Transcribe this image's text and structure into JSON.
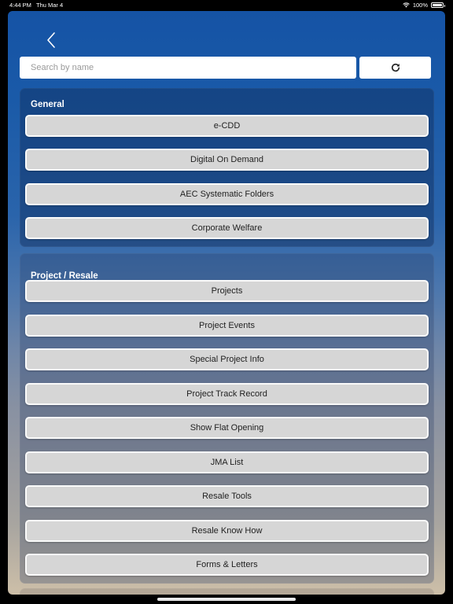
{
  "status_bar": {
    "time": "4:44 PM",
    "date": "Thu Mar 4",
    "battery": "100%"
  },
  "search": {
    "placeholder": "Search by name",
    "value": ""
  },
  "icons": {
    "back": "chevron-left-icon",
    "refresh": "refresh-icon"
  },
  "sections": {
    "general": {
      "title": "General",
      "items": [
        "e-CDD",
        "Digital On Demand",
        "AEC Systematic Folders",
        "Corporate Welfare"
      ]
    },
    "project": {
      "title": "Project / Resale",
      "items": [
        "Projects",
        "Project Events",
        "Special Project Info",
        "Project Track Record",
        "Show Flat Opening",
        "JMA List",
        "Resale Tools",
        "Resale Know How",
        "Forms & Letters"
      ]
    }
  },
  "colors": {
    "background_top": "#1553a5",
    "background_bottom": "#cdbfa8",
    "button_fill": "#d6d6d6",
    "button_border": "#fafafa"
  }
}
